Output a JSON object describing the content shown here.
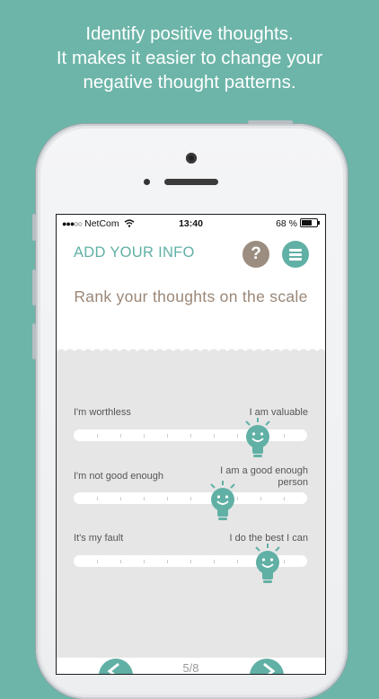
{
  "promo": {
    "line1": "Identify positive thoughts.",
    "line2": "It makes it easier to change your",
    "line3": "negative thought patterns."
  },
  "status_bar": {
    "signal": "●●●○○",
    "carrier": "NetCom",
    "time": "13:40",
    "battery": "68 %"
  },
  "nav": {
    "title": "ADD YOUR INFO",
    "help_label": "?"
  },
  "prompt": "Rank your thoughts on the scale",
  "scales": [
    {
      "left": "I'm worthless",
      "right": "I am valuable",
      "value": 0.79
    },
    {
      "left": "I'm not good enough",
      "right": "I am a good enough person",
      "value": 0.64
    },
    {
      "left": "It's my fault",
      "right": "I do the best I can",
      "value": 0.83
    }
  ],
  "pager": "5/8",
  "colors": {
    "background": "#6db5a9",
    "accent": "#61b0a5",
    "help": "#9b8d80",
    "prompt_text": "#9b8777"
  }
}
